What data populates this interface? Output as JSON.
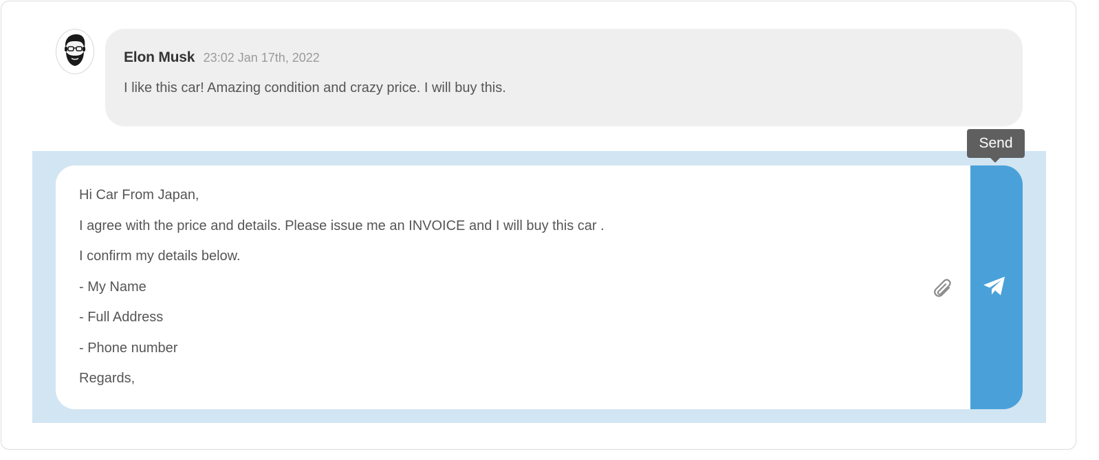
{
  "comment": {
    "author": "Elon Musk",
    "timestamp": "23:02 Jan 17th, 2022",
    "text": "I like this car! Amazing condition and crazy price. I will buy this.",
    "avatar_icon": "bearded-man-avatar-icon"
  },
  "composer": {
    "lines": [
      "Hi Car From Japan,",
      "I agree with the price and details. Please issue me an INVOICE and I will buy this car .",
      "I confirm my details below.",
      "- My Name",
      "- Full Address",
      "- Phone number",
      "Regards,"
    ],
    "attach_icon": "paperclip-icon",
    "send_icon": "paper-plane-icon",
    "send_tooltip": "Send"
  },
  "colors": {
    "compose_background": "#d2e5f3",
    "send_button": "#4aa1d9",
    "bubble_background": "#efefef",
    "tooltip_background": "#5f5f5f"
  }
}
